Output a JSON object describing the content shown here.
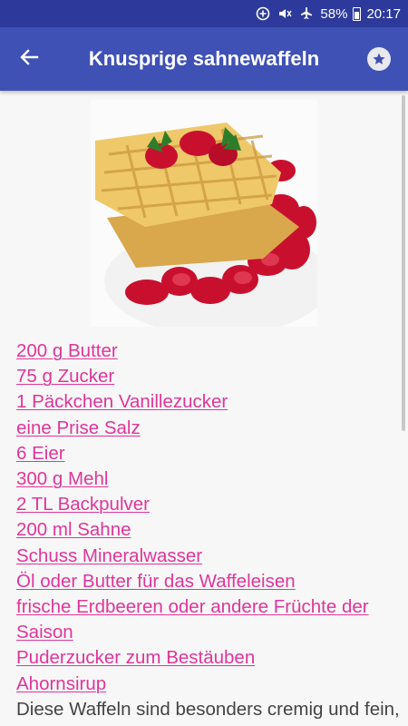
{
  "status": {
    "battery": "58%",
    "time": "20:17",
    "icons": [
      "data-saver-icon",
      "mute-icon",
      "airplane-icon",
      "battery-icon"
    ]
  },
  "app_bar": {
    "title": "Knusprige sahnewaffeln",
    "back_icon": "arrow-left-icon",
    "favorite_icon": "star-icon"
  },
  "recipe": {
    "image": "waffles-with-strawberries-photo",
    "ingredients": [
      "200 g Butter",
      "75 g Zucker",
      "1 Päckchen Vanillezucker",
      "eine Prise Salz",
      "6 Eier",
      "300 g Mehl",
      "2 TL Backpulver",
      "200 ml Sahne",
      "Schuss Mineralwasser",
      "Öl oder Butter für das Waffeleisen",
      "frische Erdbeeren oder andere Früchte der Saison",
      "Puderzucker zum Bestäuben",
      "Ahornsirup"
    ],
    "description": "Diese Waffeln sind besonders cremig und fein, die Sahne sorgt dafür, dass die Waffeln innen"
  },
  "colors": {
    "status_bar": "#2d3a9c",
    "app_bar": "#3f51b5",
    "link": "#e0359b",
    "background": "#f7f7f7"
  }
}
